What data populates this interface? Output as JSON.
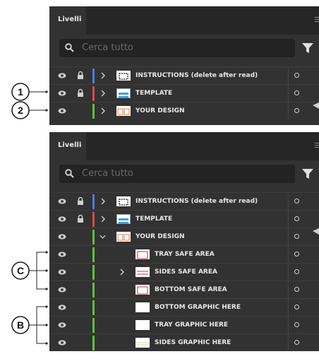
{
  "panel1": {
    "tab_label": "Livelli",
    "search_placeholder": "Cerca tutto",
    "layers": [
      {
        "name": "INSTRUCTIONS (delete after read)",
        "color": "#4a7fe0",
        "locked": true,
        "expanded": false
      },
      {
        "name": "TEMPLATE",
        "color": "#e04848",
        "locked": true,
        "expanded": false
      },
      {
        "name": "YOUR DESIGN",
        "color": "#5cc23a",
        "locked": false,
        "expanded": false
      }
    ]
  },
  "panel2": {
    "tab_label": "Livelli",
    "search_placeholder": "Cerca tutto",
    "layers": [
      {
        "name": "INSTRUCTIONS (delete after read)",
        "color": "#4a7fe0",
        "locked": true,
        "expanded": false
      },
      {
        "name": "TEMPLATE",
        "color": "#e04848",
        "locked": true,
        "expanded": false
      },
      {
        "name": "YOUR DESIGN",
        "color": "#5cc23a",
        "locked": false,
        "expanded": true
      },
      {
        "name": "TRAY SAFE AREA",
        "color": "#5cc23a",
        "sublayer": true
      },
      {
        "name": "SIDES SAFE AREA",
        "color": "#5cc23a",
        "sublayer": true,
        "has_children": true
      },
      {
        "name": "BOTTOM SAFE AREA",
        "color": "#5cc23a",
        "sublayer": true
      },
      {
        "name": "BOTTOM GRAPHIC HERE",
        "color": "#5cc23a",
        "sublayer": true
      },
      {
        "name": "TRAY GRAPHIC HERE",
        "color": "#5cc23a",
        "sublayer": true
      },
      {
        "name": "SIDES GRAPHIC HERE",
        "color": "#5cc23a",
        "sublayer": true
      }
    ]
  },
  "callouts": {
    "one": "1",
    "two": "2",
    "c": "C",
    "b": "B"
  }
}
